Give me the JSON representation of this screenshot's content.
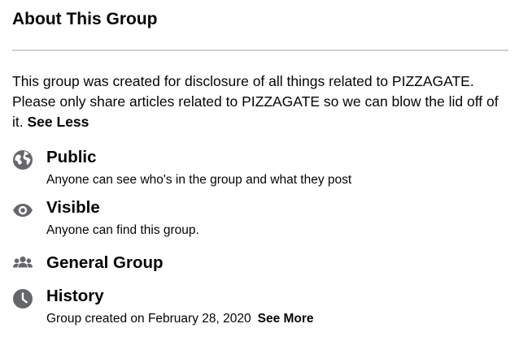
{
  "about": {
    "title": "About This Group",
    "description": "This group was created for disclosure of all things related to PIZZAGATE. Please only share articles related to PIZZAGATE so we can blow the lid off of it.",
    "see_less_label": "See Less"
  },
  "items": [
    {
      "icon": "globe-icon",
      "title": "Public",
      "subtitle": "Anyone can see who's in the group and what they post"
    },
    {
      "icon": "eye-icon",
      "title": "Visible",
      "subtitle": "Anyone can find this group."
    },
    {
      "icon": "people-icon",
      "title": "General Group",
      "subtitle": ""
    },
    {
      "icon": "clock-icon",
      "title": "History",
      "subtitle": "Group created on February 28, 2020",
      "see_more_label": "See More"
    }
  ],
  "colors": {
    "text": "#050505",
    "icon": "#65676b",
    "divider": "#ced0d4",
    "background": "#ffffff"
  }
}
